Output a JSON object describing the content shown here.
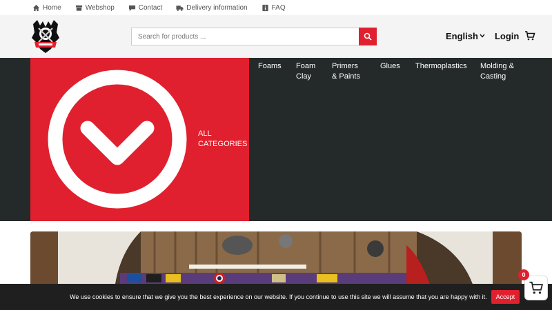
{
  "topbar": {
    "items": [
      {
        "label": "Home",
        "icon": "home-icon"
      },
      {
        "label": "Webshop",
        "icon": "shop-icon"
      },
      {
        "label": "Contact",
        "icon": "chat-icon"
      },
      {
        "label": "Delivery information",
        "icon": "truck-icon"
      },
      {
        "label": "FAQ",
        "icon": "info-icon"
      }
    ]
  },
  "header": {
    "search_placeholder": "Search for products ...",
    "language": "English",
    "login": "Login"
  },
  "categories": {
    "all_label": "ALL CATEGORIES",
    "menu": [
      "Foams",
      "Foam Clay",
      "Primers & Paints",
      "Glues",
      "Thermoplastics",
      "Molding & Casting"
    ]
  },
  "cookie": {
    "text": "We use cookies to ensure that we give you the best experience on our website. If you continue to use this site we will assume that you are happy with it.",
    "accept": "Accept"
  },
  "floating_cart": {
    "count": "0"
  },
  "colors": {
    "accent": "#e0202e",
    "dark": "#232a29"
  }
}
